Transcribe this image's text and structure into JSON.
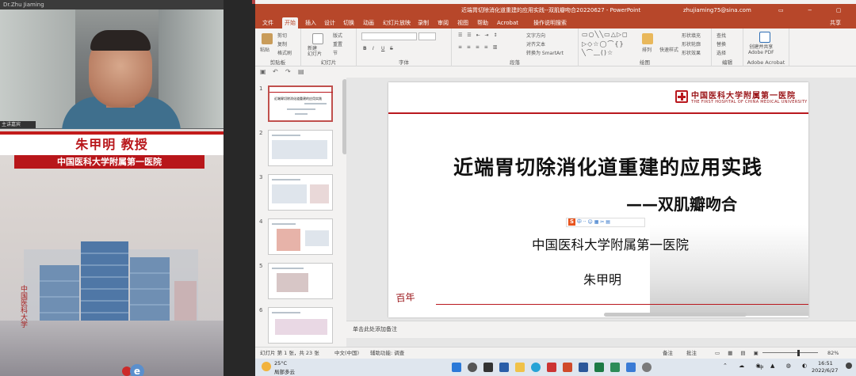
{
  "left_panel": {
    "video_title": "Dr.Zhu Jiaming",
    "video_tag": "主讲嘉宾",
    "speaker_name": "朱甲明 教授",
    "hospital": "中国医科大学附属第一医院",
    "calligraphy": "中国医科大学"
  },
  "powerpoint": {
    "title": "近端胃切除消化道重建的应用实践--双肌瓣吻合20220627  -  PowerPoint",
    "account": "zhujiaming75@sina.com",
    "window_controls": "▭ − ▢ ✕",
    "share_label": "共享",
    "tabs": [
      "文件",
      "开始",
      "插入",
      "设计",
      "切换",
      "动画",
      "幻灯片放映",
      "录制",
      "审阅",
      "视图",
      "帮助",
      "Acrobat",
      "操作说明搜索"
    ],
    "active_tab": "开始",
    "ribbon": {
      "clipboard": {
        "label": "剪贴板",
        "paste": "粘贴",
        "cut": "剪切",
        "copy": "复制",
        "painter": "格式刷"
      },
      "slides": {
        "label": "幻灯片",
        "new_slide": "新建\n幻灯片",
        "layout": "版式",
        "reset": "重置",
        "section": "节"
      },
      "font": {
        "label": "字体",
        "font_name": "",
        "font_size": "",
        "bold": "B",
        "italic": "I",
        "underline": "U",
        "strike": "S"
      },
      "paragraph": {
        "label": "段落",
        "text_direction": "文字方向",
        "align_text": "对齐文本",
        "smartart": "转换为 SmartArt"
      },
      "drawing": {
        "label": "绘图",
        "arrange": "排列",
        "quick_styles": "快速样式",
        "fill": "形状填充",
        "outline": "形状轮廓",
        "effects": "形状效果"
      },
      "editing": {
        "label": "编辑",
        "find": "查找",
        "replace": "替换",
        "select": "选择"
      },
      "acrobat": {
        "label": "Adobe Acrobat",
        "create": "创建并共享\nAdobe PDF"
      }
    },
    "thumbnails": [
      {
        "num": "1",
        "title": "近端胃切除消化道重建的应用实践"
      },
      {
        "num": "2",
        "title": ""
      },
      {
        "num": "3",
        "title": ""
      },
      {
        "num": "4",
        "title": ""
      },
      {
        "num": "5",
        "title": ""
      },
      {
        "num": "6",
        "title": ""
      }
    ],
    "slide": {
      "hospital_cn": "中国医科大学附属第一医院",
      "hospital_en": "THE FIRST HOSPITAL OF CHINA MEDICAL UNIVERSITY",
      "title": "近端胃切除消化道重建的应用实践",
      "subtitle": "——双肌瓣吻合",
      "institution": "中国医科大学附属第一医院",
      "speaker": "朱甲明",
      "stamp": "百年"
    },
    "ime_toolbar": "中 ·· ☺ ▦ ✂ ▤",
    "notes_placeholder": "单击此处添加备注",
    "status": {
      "slide_count": "幻灯片 第 1 张，共 23 张",
      "language": "中文(中国)",
      "accessibility": "辅助功能: 调查",
      "notes_btn": "备注",
      "comments_btn": "批注",
      "zoom": "82%"
    },
    "taskbar": {
      "weather_temp": "25°C",
      "weather_desc": "局部多云",
      "ime": "中",
      "time": "16:51",
      "date": "2022/6/27"
    }
  }
}
